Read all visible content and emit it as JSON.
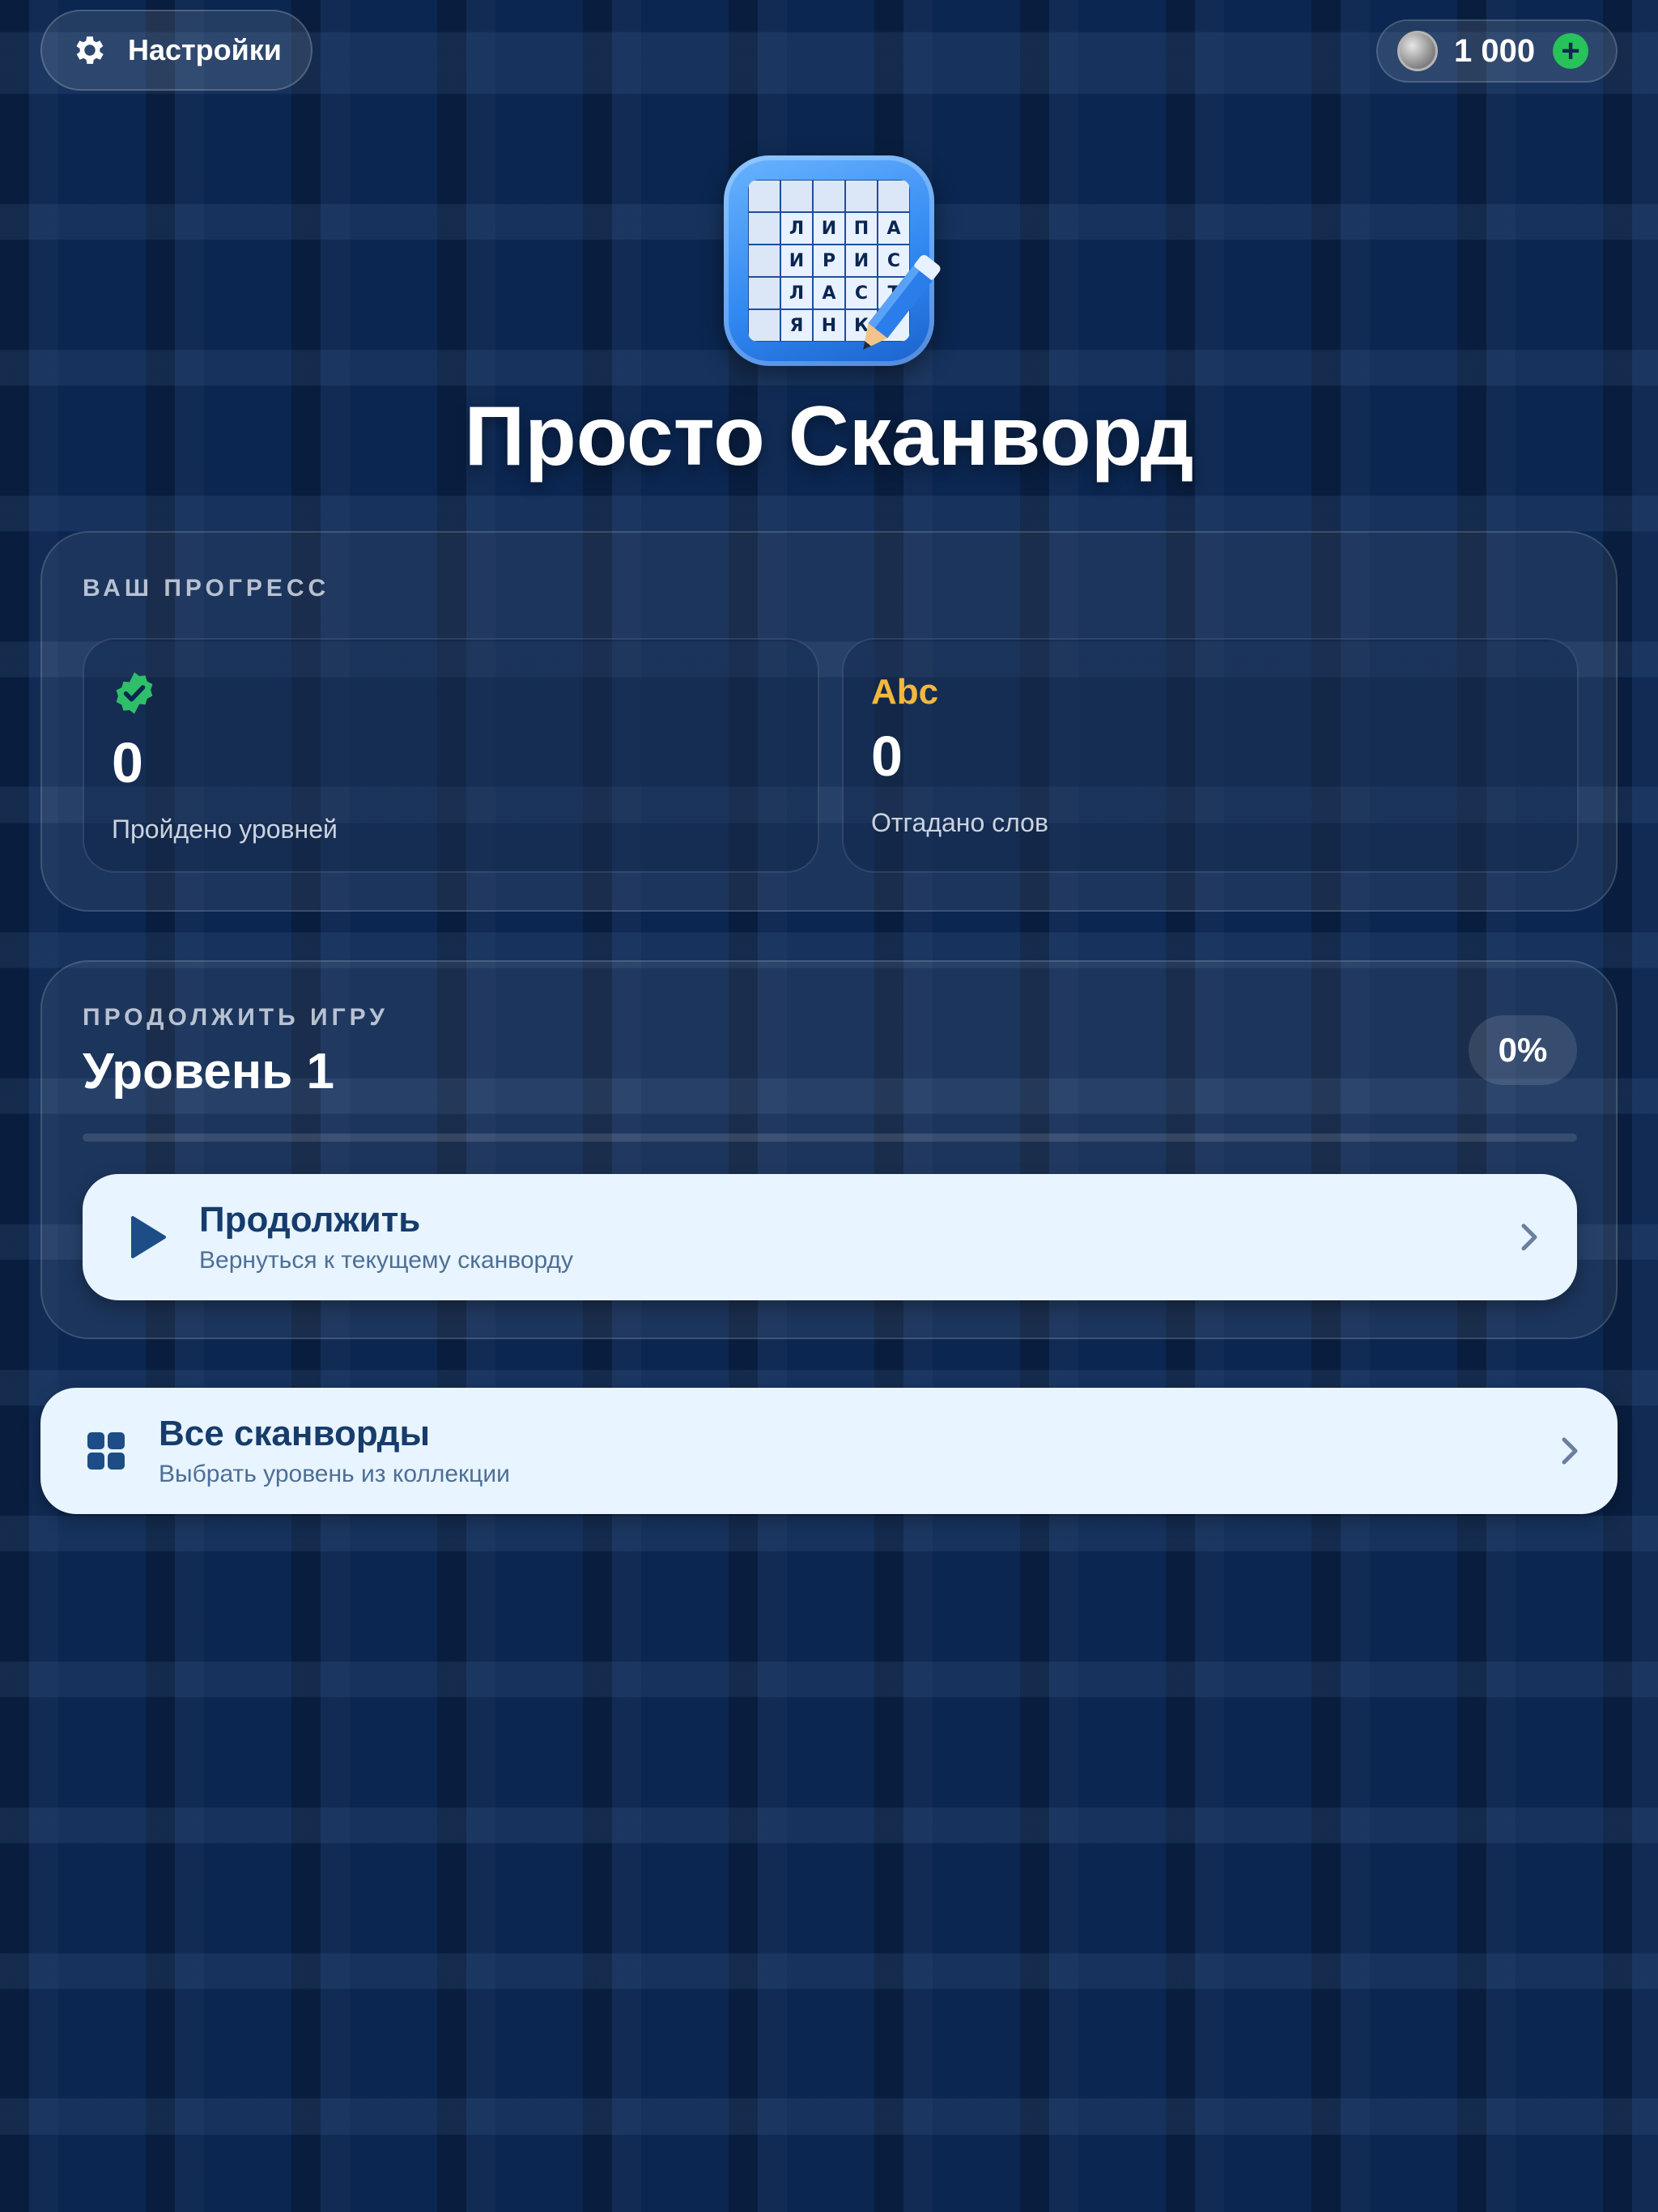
{
  "header": {
    "settings_label": "Настройки",
    "coins": "1 000",
    "add_coins_symbol": "+"
  },
  "logo": {
    "clue_row": [
      "",
      "",
      "",
      "",
      ""
    ],
    "rows": [
      [
        "",
        "Л",
        "И",
        "П",
        "А"
      ],
      [
        "",
        "И",
        "Р",
        "И",
        "С"
      ],
      [
        "",
        "Л",
        "А",
        "С",
        "Т"
      ],
      [
        "",
        "Я",
        "Н",
        "К",
        ""
      ]
    ]
  },
  "title": "Просто Сканворд",
  "progress": {
    "label": "ВАШ ПРОГРЕСС",
    "levels_completed": {
      "value": "0",
      "caption": "Пройдено уровней"
    },
    "words_guessed": {
      "icon_text": "Abc",
      "value": "0",
      "caption": "Отгадано слов"
    }
  },
  "continue": {
    "label": "ПРОДОЛЖИТЬ ИГРУ",
    "level": "Уровень 1",
    "percent": "0%",
    "progress_fraction": 0,
    "button_title": "Продолжить",
    "button_subtitle": "Вернуться к текущему сканворду"
  },
  "all_scanwords": {
    "title": "Все сканворды",
    "subtitle": "Выбрать уровень из коллекции"
  },
  "colors": {
    "background": "#0b2650",
    "accent_green": "#27c25a",
    "accent_yellow": "#f2b83c",
    "button_bg": "#e8f4ff",
    "button_text": "#163c6c"
  },
  "icons": [
    "gear-icon",
    "coin-icon",
    "plus-icon",
    "verified-check-icon",
    "play-icon",
    "grid-icon",
    "chevron-right-icon"
  ]
}
